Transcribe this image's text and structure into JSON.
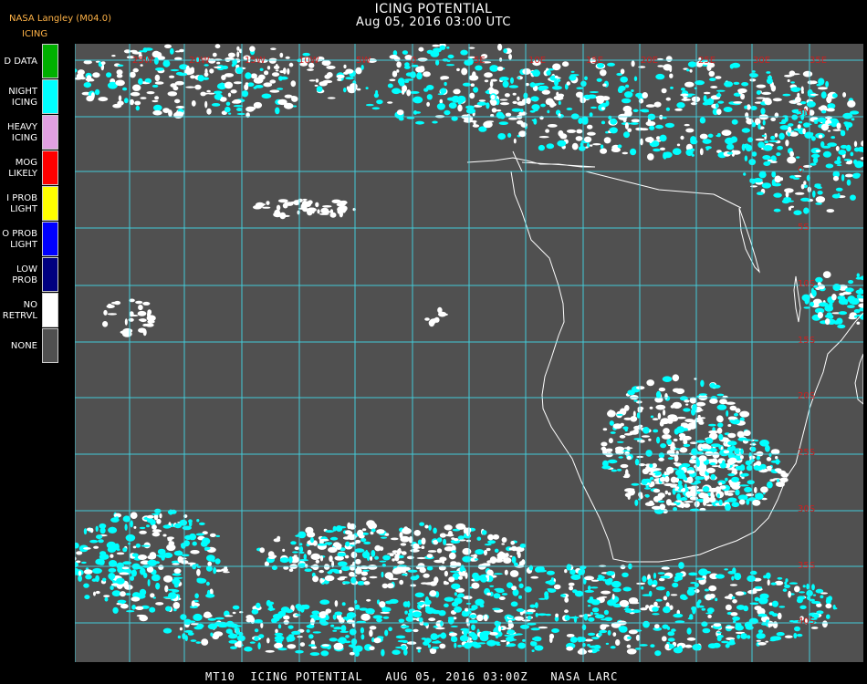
{
  "header": {
    "title": "ICING POTENTIAL",
    "subtitle": "Aug 05, 2016 03:00 UTC",
    "source": "NASA Langley (M04.0)",
    "legend_title": "ICING"
  },
  "legend": [
    {
      "label": [
        "D DATA"
      ],
      "color": "#00b000"
    },
    {
      "label": [
        "NIGHT",
        "ICING"
      ],
      "color": "#00ffff"
    },
    {
      "label": [
        "HEAVY",
        "ICING"
      ],
      "color": "#e0a0e0"
    },
    {
      "label": [
        "MOG",
        "LIKELY"
      ],
      "color": "#ff0000"
    },
    {
      "label": [
        "I PROB",
        "LIGHT"
      ],
      "color": "#ffff00"
    },
    {
      "label": [
        "O PROB",
        "LIGHT"
      ],
      "color": "#0000ff"
    },
    {
      "label": [
        "LOW",
        "PROB"
      ],
      "color": "#000080"
    },
    {
      "label": [
        "NO",
        "RETRVL"
      ],
      "color": "#ffffff"
    },
    {
      "label": [
        "NONE"
      ],
      "color": "#505050"
    }
  ],
  "map": {
    "background": "#505050",
    "grid_color": "#40e0f0",
    "label_color": "#cc2020",
    "lon_labels": [
      "25W",
      "20W",
      "15W",
      "10W",
      "5W",
      "0",
      "5E",
      "10E",
      "15E",
      "20E",
      "25E",
      "30E",
      "35E"
    ],
    "lat_labels": [
      "5N",
      "0",
      "5S",
      "10S",
      "15S",
      "20S",
      "25S",
      "30S",
      "35S",
      "40S"
    ]
  },
  "footer": "MT10  ICING POTENTIAL   AUG 05, 2016 03:00Z   NASA LARC"
}
